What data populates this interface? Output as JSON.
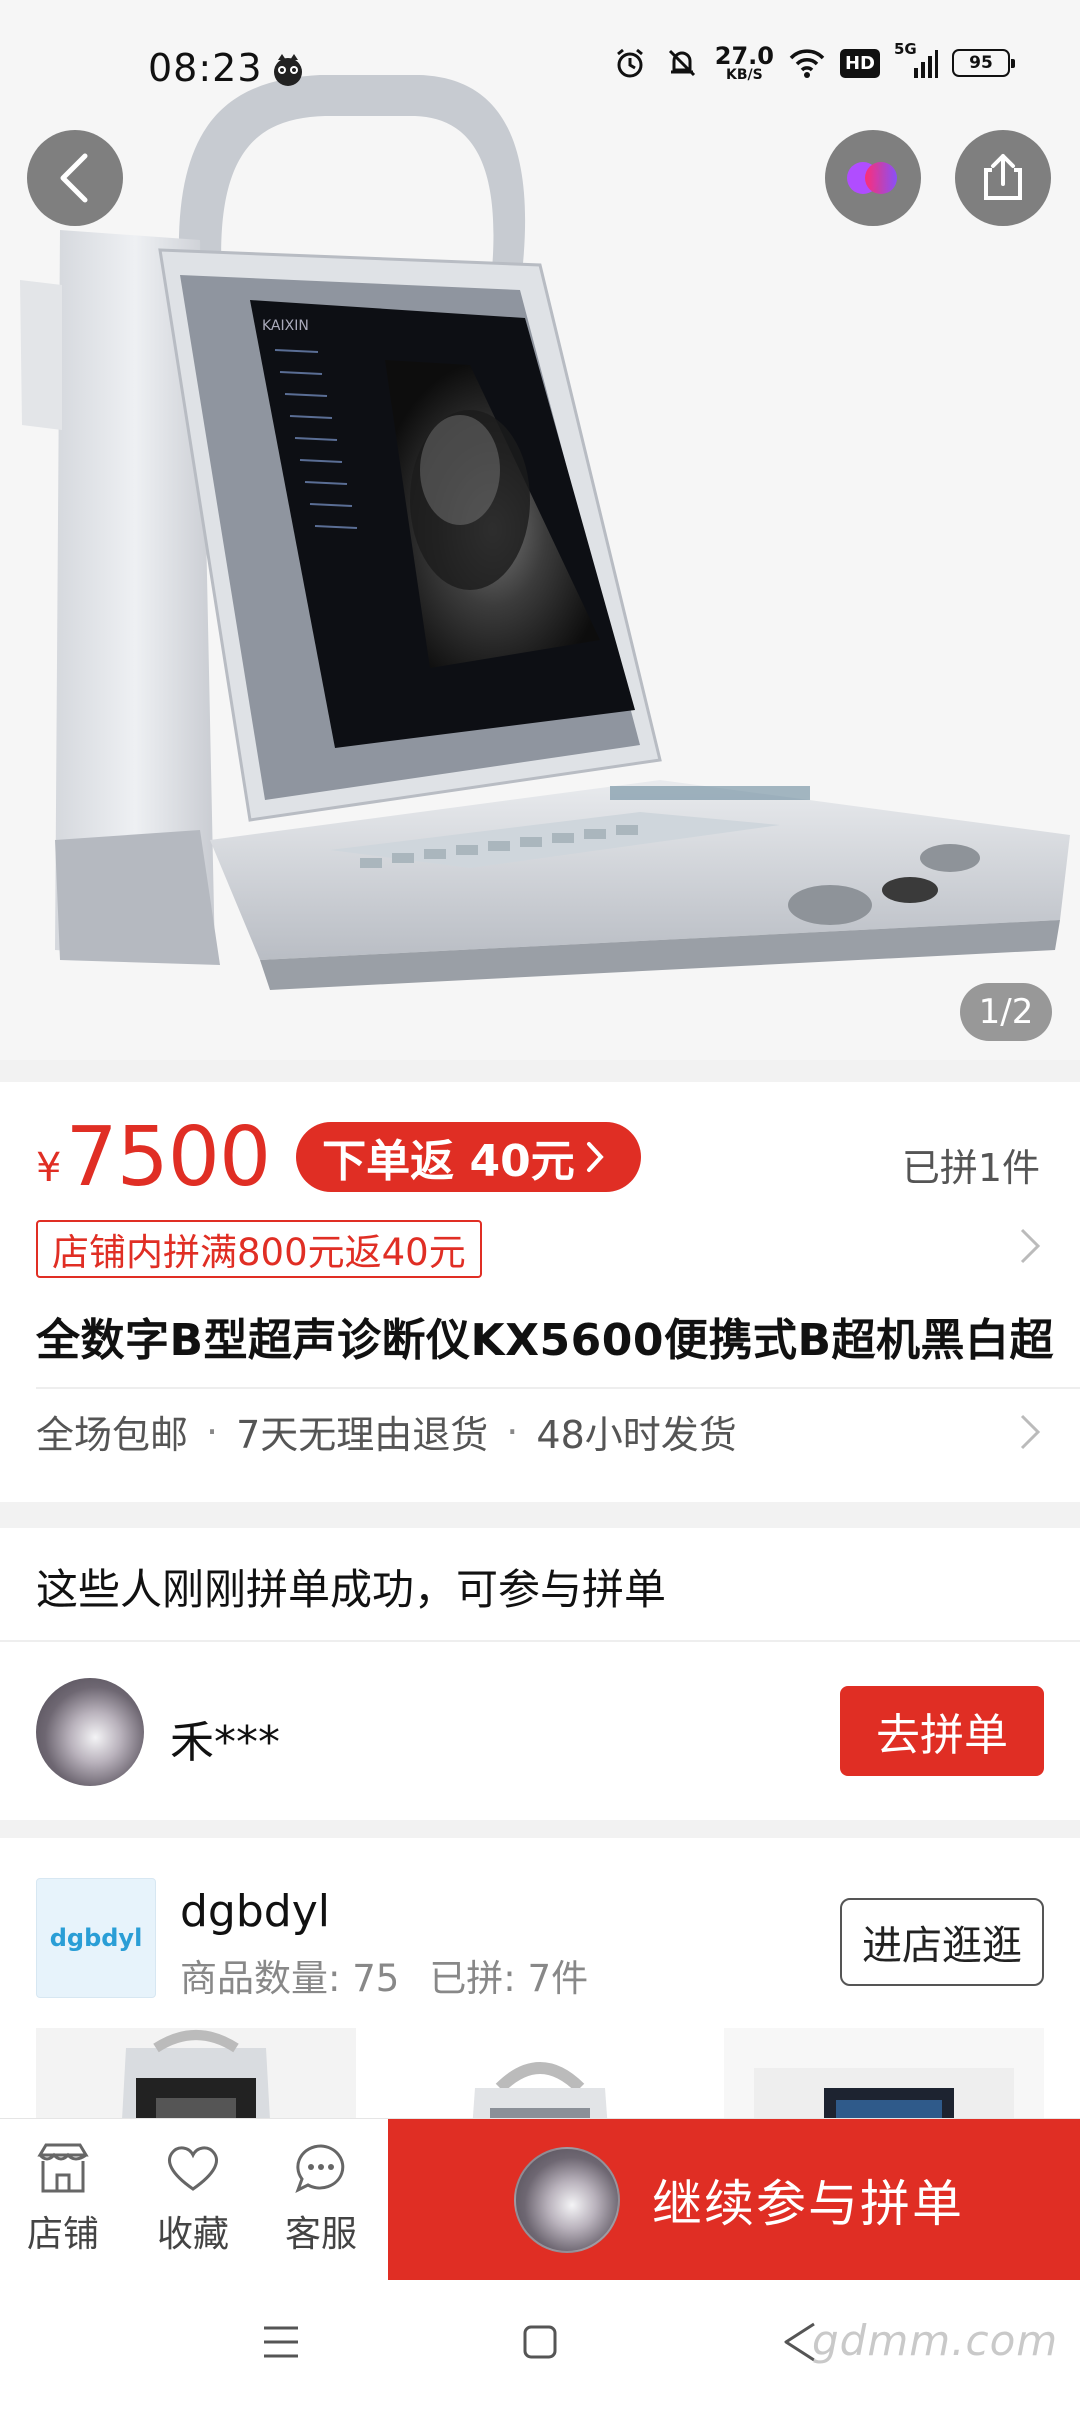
{
  "status_bar": {
    "time": "08:23",
    "net_speed_value": "27.0",
    "net_speed_unit": "KB/S",
    "hd_label": "HD",
    "signal_label": "5G",
    "battery_level": "95"
  },
  "hero": {
    "image_counter": "1/2",
    "screen_brand": "KAIXIN"
  },
  "product": {
    "currency": "¥",
    "price": "7500",
    "rebate_badge": "下单返 40元",
    "sold_count": "已拼1件",
    "promo_tag": "店铺内拼满800元返40元",
    "title": "全数字B型超声诊断仪KX5600便携式B超机黑白超",
    "services": [
      "全场包邮",
      "7天无理由退货",
      "48小时发货"
    ],
    "service_separator": "·"
  },
  "group_buy": {
    "title": "这些人刚刚拼单成功，可参与拼单",
    "user_name": "禾***",
    "join_label": "去拼单"
  },
  "store": {
    "logo_text": "dgbdyl",
    "name": "dgbdyl",
    "product_count": "商品数量: 75",
    "sold": "已拼: 7件",
    "visit_label": "进店逛逛"
  },
  "bottom_bar": {
    "tabs": [
      {
        "label": "店铺",
        "icon": "shop-icon"
      },
      {
        "label": "收藏",
        "icon": "heart-icon"
      },
      {
        "label": "客服",
        "icon": "chat-icon"
      }
    ],
    "cta_label": "继续参与拼单"
  },
  "system_nav": {
    "watermark": "gdmm.com"
  },
  "colors": {
    "accent": "#e02e24",
    "store_logo_text": "#2a9ed6",
    "brand_gradient_start": "#ff2d6f",
    "brand_gradient_end": "#8a4dff"
  }
}
